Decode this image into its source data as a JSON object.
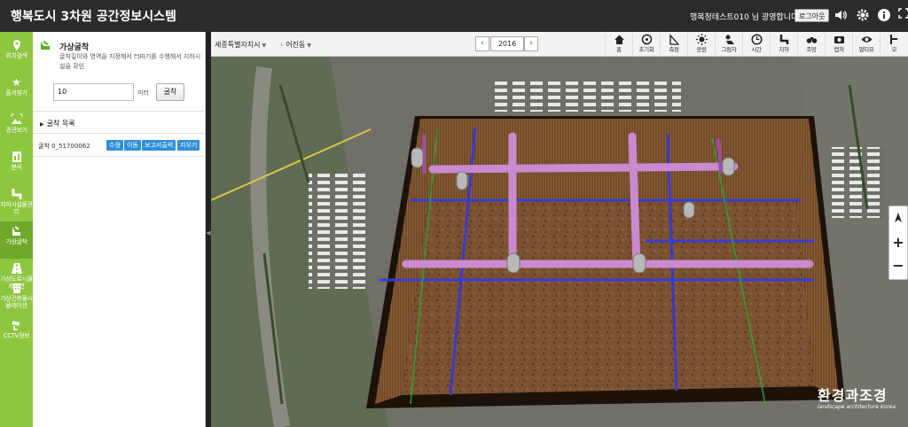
{
  "app": {
    "title": "행복도시 3차원 공간정보시스템",
    "welcome": "행복청테스트010 님 광영합니다.",
    "logout_label": "로그아웃",
    "top_icons": [
      "speaker-icon",
      "gear-icon",
      "info-icon",
      "fullscreen-icon"
    ]
  },
  "nav": {
    "items": [
      {
        "label": "위치검색",
        "icon": "location-pin-icon"
      },
      {
        "label": "즐겨찾기",
        "icon": "star-icon"
      },
      {
        "label": "경관보기",
        "icon": "landscape-icon"
      },
      {
        "label": "분석",
        "icon": "analysis-icon"
      },
      {
        "label": "지하시설물관리",
        "icon": "pipe-icon"
      },
      {
        "label": "가상굴착",
        "icon": "excavator-icon"
      },
      {
        "label": "가상도로시뮬레이션",
        "icon": "road-icon"
      },
      {
        "label": "가상건축물시뮬레이션",
        "icon": "building-icon"
      },
      {
        "label": "CCTV정보",
        "icon": "cctv-icon"
      }
    ]
  },
  "panel": {
    "title": "가상굴착",
    "description": "굴착깊이와 영역을 지정해서 터파기를 수행해서 지하시설을 확인",
    "depth_value": "10",
    "unit": "미터",
    "dig_button": "굴착",
    "list_title": "굴착 목록",
    "rows": [
      {
        "name": "굴착 0_51700062",
        "actions": [
          "수정",
          "이동",
          "보고서출력",
          "지우기"
        ]
      }
    ]
  },
  "toolbar": {
    "region": "세종특별자치시",
    "district": "어진동",
    "year": "2016",
    "prev_label": "‹",
    "next_label": "›",
    "tools": [
      {
        "label": "홈",
        "icon": "home-icon"
      },
      {
        "label": "초기화",
        "icon": "reset-icon"
      },
      {
        "label": "측정",
        "icon": "measure-icon"
      },
      {
        "label": "광원",
        "icon": "light-icon"
      },
      {
        "label": "그림자",
        "icon": "shadow-icon"
      },
      {
        "label": "시간",
        "icon": "clock-icon"
      },
      {
        "label": "지하",
        "icon": "underground-icon"
      },
      {
        "label": "조망",
        "icon": "binoculars-icon"
      },
      {
        "label": "캡쳐",
        "icon": "camera-icon"
      },
      {
        "label": "멀티뷰",
        "icon": "eye-icon"
      },
      {
        "label": "모",
        "icon": "tool-icon"
      }
    ]
  },
  "map_controls": {
    "compass_icon": "compass-icon",
    "zoom_in": "+",
    "zoom_out": "−"
  },
  "watermark": {
    "main": "환경과조경",
    "sub": "landscape architecture korea"
  },
  "colors": {
    "nav_green": "#8dc63f",
    "topbar": "#2b2b2b",
    "action_blue": "#2f8fd8",
    "pipe_pink": "#c98ad0",
    "pipe_blue": "#3a3ad0",
    "soil": "#7a5232"
  }
}
